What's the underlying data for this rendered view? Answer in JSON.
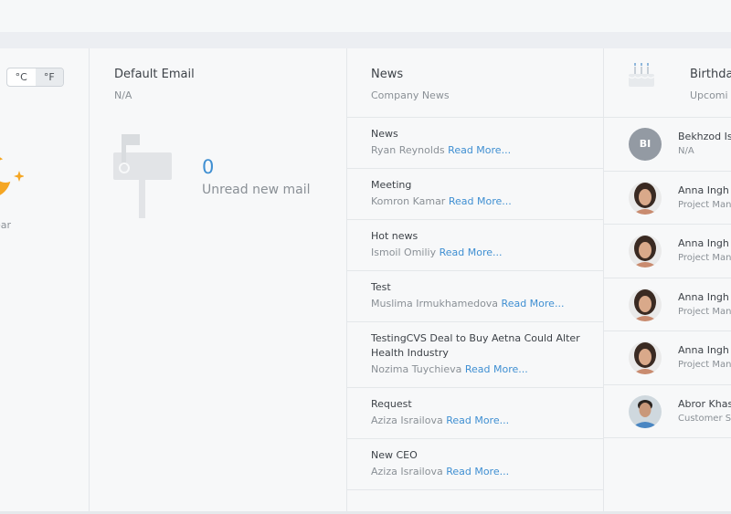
{
  "weather": {
    "unit_c": "°C",
    "unit_f": "°F",
    "condition_partial": "ear"
  },
  "email": {
    "title": "Default Email",
    "subtitle": "N/A",
    "unread_count": "0",
    "unread_label": "Unread new mail"
  },
  "news": {
    "title": "News",
    "subtitle": "Company News",
    "read_more": "Read More...",
    "items": [
      {
        "title": "News",
        "author": "Ryan Reynolds"
      },
      {
        "title": "Meeting",
        "author": "Komron Kamar"
      },
      {
        "title": "Hot news",
        "author": "Ismoil Omiliy"
      },
      {
        "title": "Test",
        "author": "Muslima Irmukhamedova"
      },
      {
        "title": "TestingCVS Deal to Buy Aetna Could Alter Health Industry",
        "author": "Nozima Tuychieva"
      },
      {
        "title": "Request",
        "author": "Aziza Israilova"
      },
      {
        "title": "New CEO",
        "author": "Aziza Israilova"
      }
    ]
  },
  "birthdays": {
    "title": "Birthda",
    "subtitle": "Upcomi",
    "people": [
      {
        "initials": "BI",
        "name": "Bekhzod Is",
        "role": "N/A"
      },
      {
        "name": "Anna Ingh",
        "role": "Project Man"
      },
      {
        "name": "Anna Ingh",
        "role": "Project Man"
      },
      {
        "name": "Anna Ingh",
        "role": "Project Man"
      },
      {
        "name": "Anna Ingh",
        "role": "Project Man"
      },
      {
        "name": "Abror Khas",
        "role": "Customer S"
      }
    ]
  },
  "colors": {
    "accent": "#3f8fd2",
    "sun": "#f5a623"
  }
}
